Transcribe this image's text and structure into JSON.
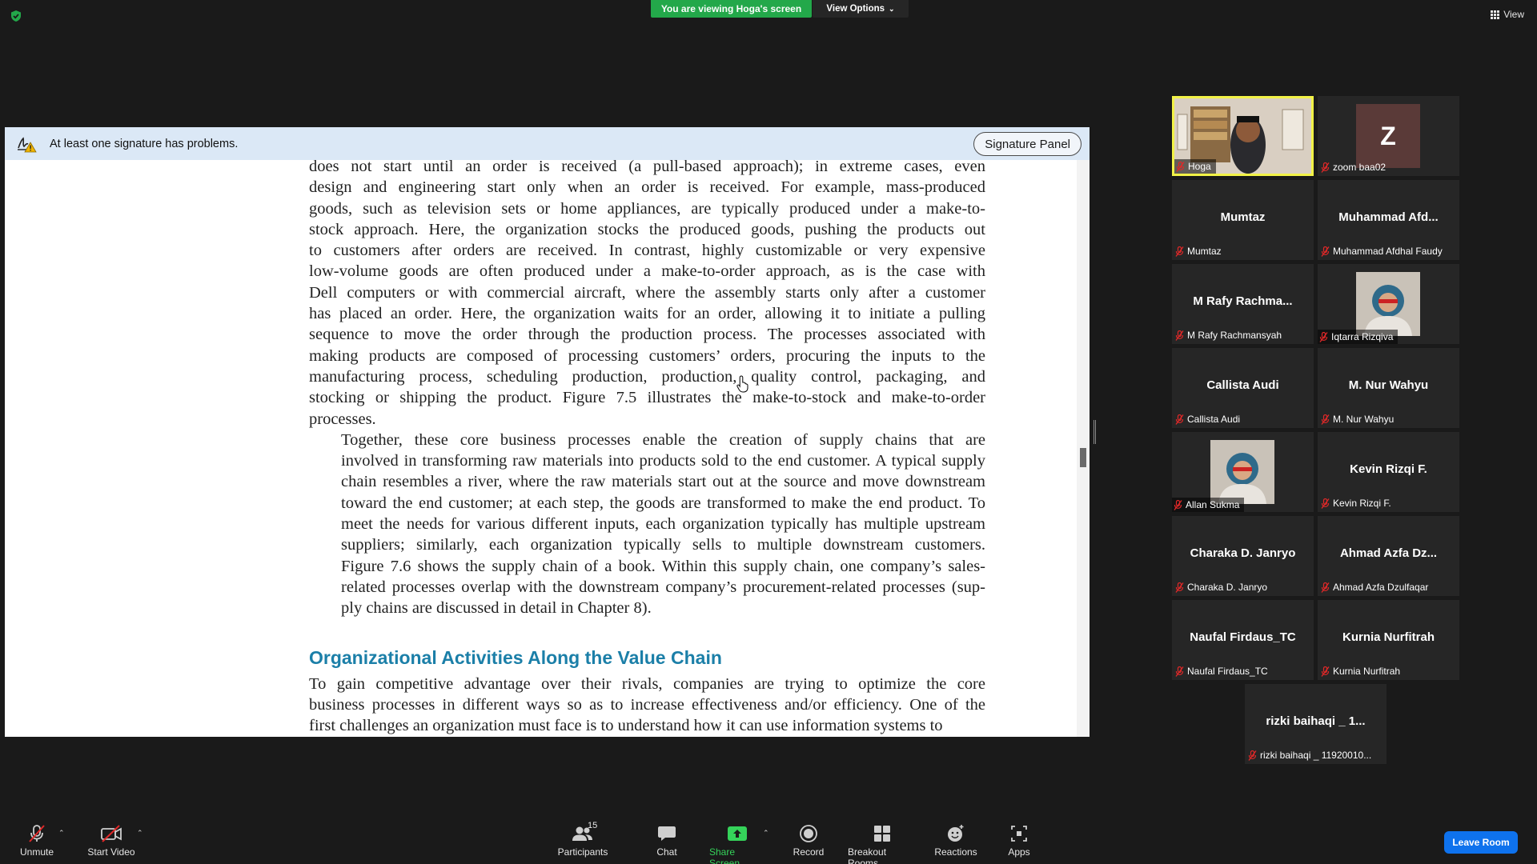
{
  "top": {
    "viewing_banner": "You are viewing Hoga's screen",
    "view_options_label": "View Options",
    "view_label": "View"
  },
  "signature_bar": {
    "message": "At least one signature has problems.",
    "panel_button": "Signature Panel"
  },
  "document": {
    "para1_lines": [
      "does not start until an order is received (a pull-based approach); in extreme cases, even",
      "design and engineering start only when an order is received. For example, mass-produced",
      "goods, such as television sets or home appliances, are typically produced under a make-to-",
      "stock approach. Here, the organization stocks the produced goods, pushing the products out",
      "to customers after orders are received. In contrast, highly customizable or very expensive",
      "low-volume goods are often produced under a make-to-order approach, as is the case with",
      "Dell computers or with commercial aircraft, where the assembly starts only after a customer",
      "has placed an order. Here, the organization waits for an order, allowing it to initiate a pulling",
      "sequence to move the order through the production process. The processes associated with",
      "making products are composed of processing customers’ orders, procuring the inputs to the",
      "manufacturing process, scheduling production, production, quality control, packaging, and",
      "stocking or shipping the product. Figure 7.5 illustrates the make-to-stock and make-to-order",
      "processes."
    ],
    "para2_lines": [
      "Together, these core business processes enable the creation of supply chains that are",
      "involved in transforming raw materials into products sold to the end customer. A typical supply",
      "chain resembles a river, where the raw materials start out at the source and move downstream",
      "toward the end customer; at each step, the goods are transformed to make the end product. To",
      "meet the needs for various different inputs, each organization typically has multiple upstream",
      "suppliers; similarly, each organization typically sells to multiple downstream customers.",
      "Figure 7.6 shows the supply chain of a book. Within this supply chain, one company’s sales-",
      "related processes overlap with the downstream company’s procurement-related processes (sup-",
      "ply chains are discussed in detail in Chapter 8)."
    ],
    "heading": "Organizational Activities Along the Value Chain",
    "para3_lines": [
      "To gain competitive advantage over their rivals, companies are trying to optimize the core",
      "business processes in different ways so as to increase effectiveness and/or efficiency. One of the",
      "first challenges an organization must face is to understand how it can use information systems to"
    ]
  },
  "participants_gallery": [
    {
      "name": "Hoga",
      "label": "Hoga",
      "video": true,
      "active": true
    },
    {
      "name": "zoom baa02",
      "label": "zoom baa02",
      "avatar_letter": "Z"
    },
    {
      "name": "Mumtaz",
      "label": "Mumtaz"
    },
    {
      "name": "Muhammad  Afd...",
      "label": "Muhammad Afdhal Faudy"
    },
    {
      "name": "M Rafy Rachma...",
      "label": "M Rafy Rachmansyah"
    },
    {
      "name": "Iqtarra Rizqiva",
      "label": "Iqtarra Rizqiva",
      "photo": true
    },
    {
      "name": "Callista Audi",
      "label": "Callista Audi"
    },
    {
      "name": "M. Nur Wahyu",
      "label": "M. Nur Wahyu"
    },
    {
      "name": "Allan Sukma",
      "label": "Allan Sukma",
      "photo": true
    },
    {
      "name": "Kevin Rizqi F.",
      "label": "Kevin Rizqi F."
    },
    {
      "name": "Charaka D. Janryo",
      "label": "Charaka D. Janryo"
    },
    {
      "name": "Ahmad Azfa Dz...",
      "label": "Ahmad Azfa Dzulfaqar"
    },
    {
      "name": "Naufal Firdaus_TC",
      "label": "Naufal Firdaus_TC"
    },
    {
      "name": "Kurnia Nurfitrah",
      "label": "Kurnia Nurfitrah"
    },
    {
      "name": "rizki baihaqi _ 1...",
      "label": "rizki baihaqi _ 11920010..."
    }
  ],
  "toolbar": {
    "unmute": "Unmute",
    "start_video": "Start Video",
    "participants": "Participants",
    "participants_count": "15",
    "chat": "Chat",
    "share_screen": "Share Screen",
    "record": "Record",
    "breakout_rooms": "Breakout Rooms",
    "reactions": "Reactions",
    "apps": "Apps",
    "leave_room": "Leave Room"
  },
  "colors": {
    "background": "#1a1a1a",
    "banner_green": "#23a84a",
    "heading_blue": "#1b7fa8",
    "active_speaker": "#f2f246",
    "leave_blue": "#0e72ed",
    "mic_off_red": "#e02828"
  }
}
